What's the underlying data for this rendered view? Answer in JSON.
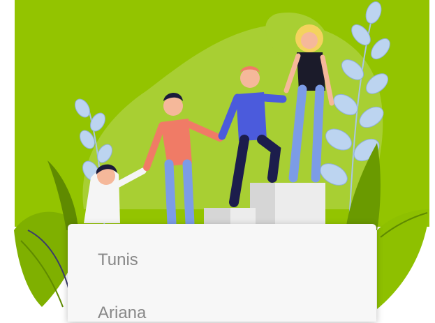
{
  "hero": {
    "illustration": "team-climbing-stairs-illustration",
    "background_color": "#93c400"
  },
  "list": {
    "items": [
      {
        "label": "Tunis"
      },
      {
        "label": "Ariana"
      }
    ]
  }
}
